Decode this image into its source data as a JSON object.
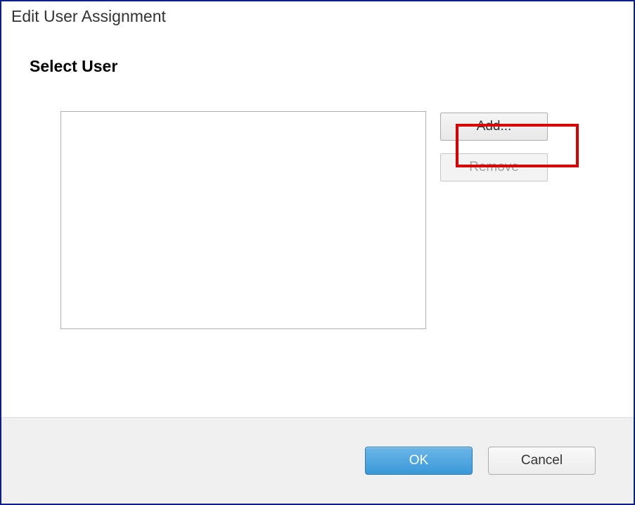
{
  "dialog": {
    "title": "Edit User Assignment",
    "section_heading": "Select User",
    "add_label": "Add...",
    "remove_label": "Remove",
    "ok_label": "OK",
    "cancel_label": "Cancel"
  }
}
